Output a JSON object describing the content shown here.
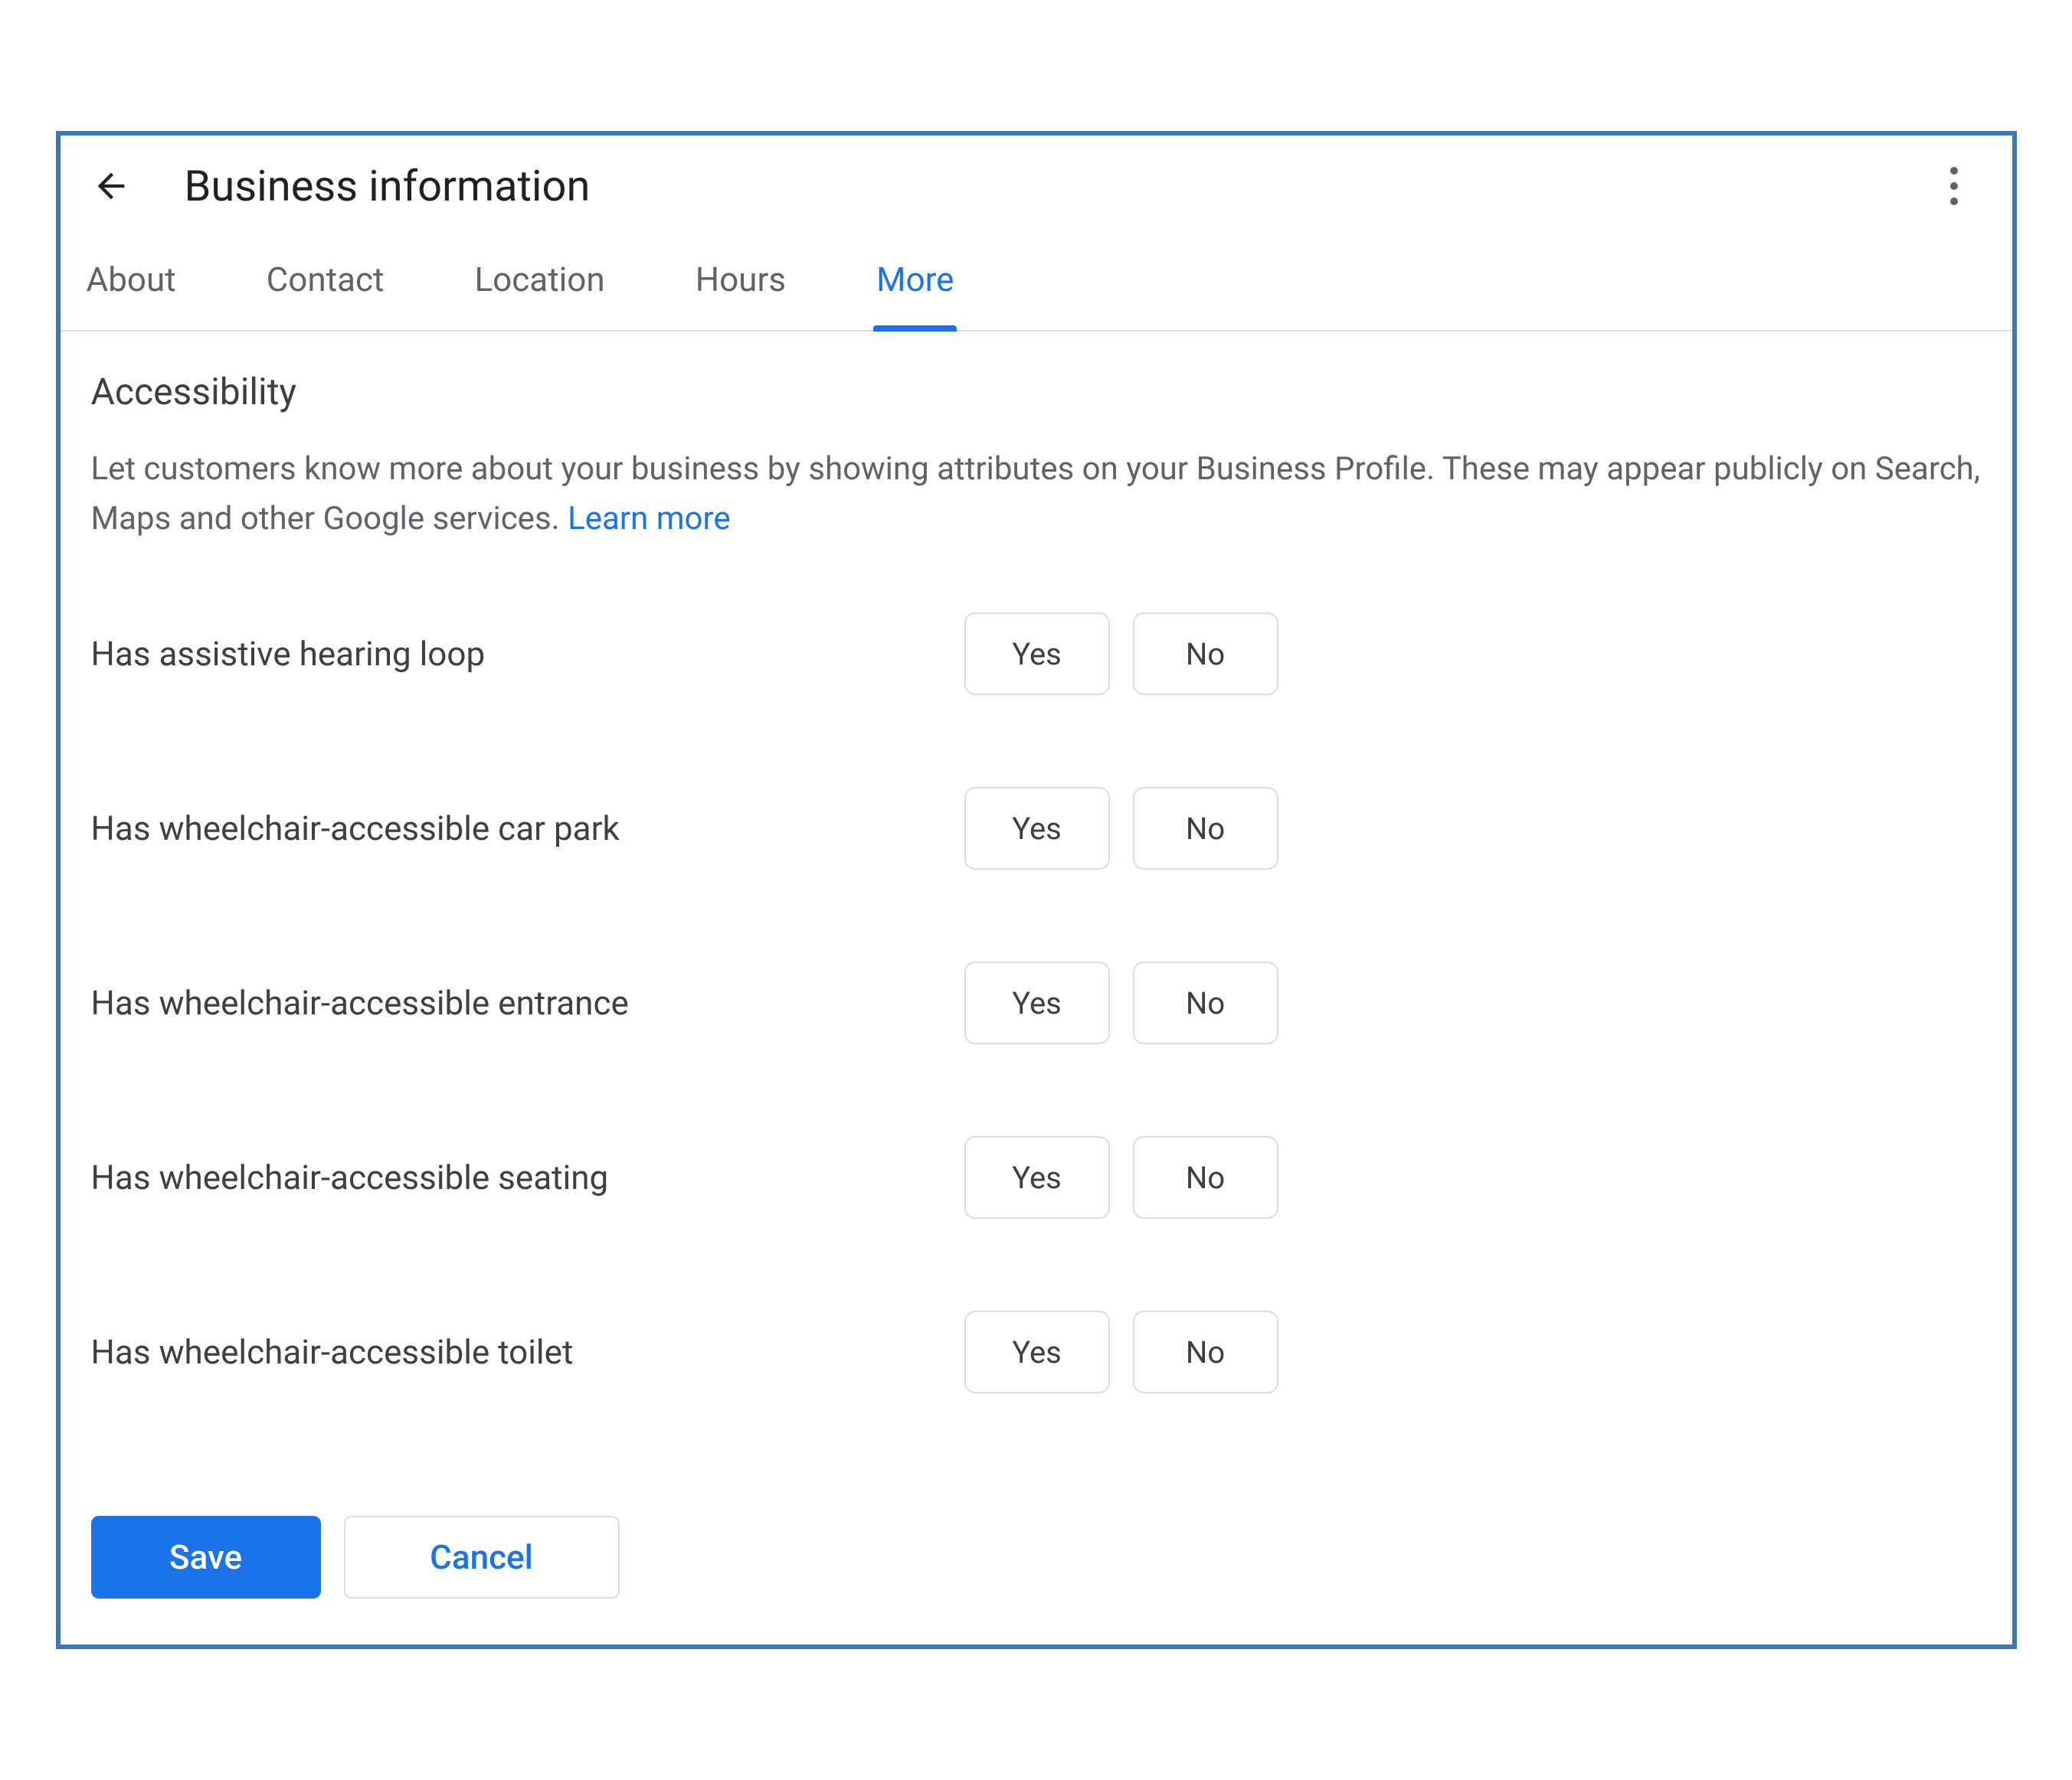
{
  "header": {
    "title": "Business information"
  },
  "tabs": [
    {
      "label": "About",
      "active": false
    },
    {
      "label": "Contact",
      "active": false
    },
    {
      "label": "Location",
      "active": false
    },
    {
      "label": "Hours",
      "active": false
    },
    {
      "label": "More",
      "active": true
    }
  ],
  "section": {
    "title": "Accessibility",
    "description": "Let customers know more about your business by showing attributes on your Business Profile. These may appear publicly on Search, Maps and other Google services. ",
    "learn_more": "Learn more"
  },
  "attributes": [
    {
      "label": "Has assistive hearing loop",
      "yes": "Yes",
      "no": "No"
    },
    {
      "label": "Has wheelchair-accessible car park",
      "yes": "Yes",
      "no": "No"
    },
    {
      "label": "Has wheelchair-accessible entrance",
      "yes": "Yes",
      "no": "No"
    },
    {
      "label": "Has wheelchair-accessible seating",
      "yes": "Yes",
      "no": "No"
    },
    {
      "label": "Has wheelchair-accessible toilet",
      "yes": "Yes",
      "no": "No"
    }
  ],
  "footer": {
    "save": "Save",
    "cancel": "Cancel"
  }
}
